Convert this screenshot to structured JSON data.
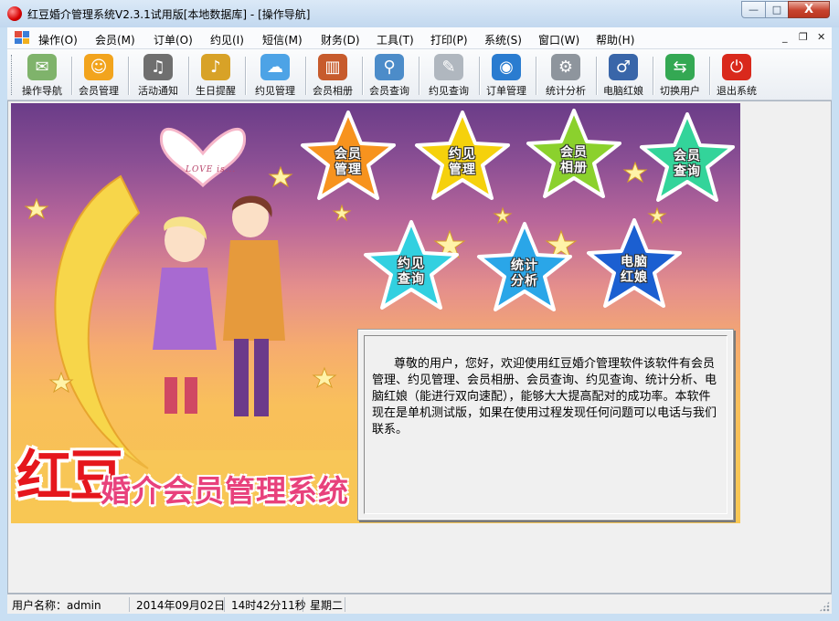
{
  "window": {
    "title": "红豆婚介管理系统V2.3.1试用版[本地数据库] - [操作导航]",
    "minimize_icon": "minimize-icon",
    "maximize_icon": "maximize-icon",
    "close_icon": "close-icon",
    "minimize_glyph": "—",
    "maximize_glyph": "□",
    "close_glyph": "X"
  },
  "menubar": {
    "items": [
      {
        "label": "操作(O)"
      },
      {
        "label": "会员(M)"
      },
      {
        "label": "订单(O)"
      },
      {
        "label": "约见(I)"
      },
      {
        "label": "短信(M)"
      },
      {
        "label": "财务(D)"
      },
      {
        "label": "工具(T)"
      },
      {
        "label": "打印(P)"
      },
      {
        "label": "系统(S)"
      },
      {
        "label": "窗口(W)"
      },
      {
        "label": "帮助(H)"
      }
    ],
    "mdi_controls": {
      "minimize": "_",
      "restore": "❐",
      "close": "✕"
    }
  },
  "toolbar": {
    "buttons": [
      {
        "label": "操作导航",
        "icon": "navigation-icon",
        "glyph": "✉",
        "color": "#7fb36b"
      },
      {
        "label": "会员管理",
        "icon": "member-icon",
        "glyph": "☺",
        "color": "#f2a41d"
      },
      {
        "label": "活动通知",
        "icon": "speaker-icon",
        "glyph": "♫",
        "color": "#6f6f6f"
      },
      {
        "label": "生日提醒",
        "icon": "music-note-icon",
        "glyph": "♪",
        "color": "#d8a227"
      },
      {
        "label": "约见管理",
        "icon": "chat-icon",
        "glyph": "☁",
        "color": "#4da3e6"
      },
      {
        "label": "会员相册",
        "icon": "album-icon",
        "glyph": "▥",
        "color": "#c75b2c"
      },
      {
        "label": "会员查询",
        "icon": "magnifier-icon",
        "glyph": "⚲",
        "color": "#4c8cc9"
      },
      {
        "label": "约见查询",
        "icon": "notepad-icon",
        "glyph": "✎",
        "color": "#b0b7bf"
      },
      {
        "label": "订单管理",
        "icon": "globe-icon",
        "glyph": "◉",
        "color": "#2a7cd0"
      },
      {
        "label": "统计分析",
        "icon": "gear-icon",
        "glyph": "⚙",
        "color": "#8e959d"
      },
      {
        "label": "电脑红娘",
        "icon": "person-icon",
        "glyph": "♂",
        "color": "#3966a9"
      },
      {
        "label": "切换用户",
        "icon": "switch-icon",
        "glyph": "⇆",
        "color": "#34a853"
      },
      {
        "label": "退出系统",
        "icon": "power-icon",
        "glyph": "⏻",
        "color": "#d9291c"
      }
    ]
  },
  "banner": {
    "heart_text": "LOVE is...",
    "logo_main": "红豆",
    "logo_sub": "婚介会员管理系统",
    "stars": [
      {
        "label_line1": "会员",
        "label_line2": "管理",
        "color": "#f7931e"
      },
      {
        "label_line1": "约见",
        "label_line2": "管理",
        "color": "#f5d10c"
      },
      {
        "label_line1": "会员",
        "label_line2": "相册",
        "color": "#8bd12d"
      },
      {
        "label_line1": "会员",
        "label_line2": "查询",
        "color": "#33d49a"
      },
      {
        "label_line1": "约见",
        "label_line2": "查询",
        "color": "#32d0e0"
      },
      {
        "label_line1": "统计",
        "label_line2": "分析",
        "color": "#2aa6e8"
      },
      {
        "label_line1": "电脑",
        "label_line2": "红娘",
        "color": "#1b5fd1"
      }
    ]
  },
  "info_panel": {
    "text": "尊敬的用户，您好，欢迎使用红豆婚介管理软件该软件有会员管理、约见管理、会员相册、会员查询、约见查询、统计分析、电脑红娘（能进行双向速配），能够大大提高配对的成功率。本软件现在是单机测试版，如果在使用过程发现任何问题可以电话与我们联系。"
  },
  "statusbar": {
    "user": "用户名称：admin",
    "date": "2014年09月02日",
    "time": "14时42分11秒",
    "weekday": "星期二"
  }
}
